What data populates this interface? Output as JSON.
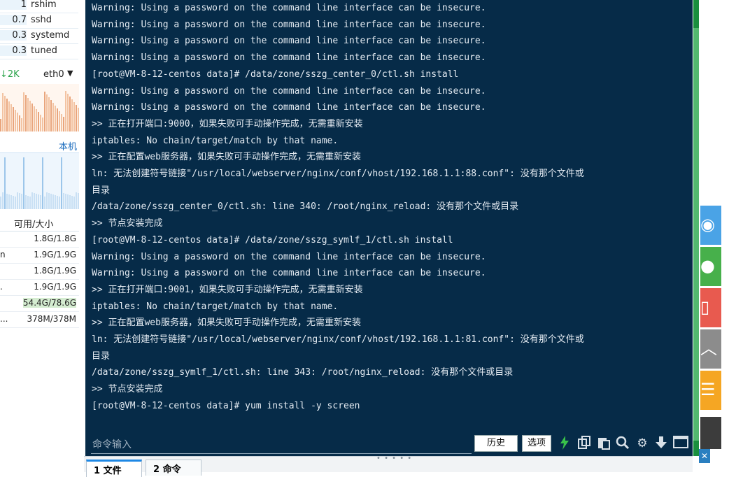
{
  "processes": [
    {
      "mem": "1",
      "name": "rshim"
    },
    {
      "mem": "0.7",
      "name": "sshd"
    },
    {
      "mem": "0.3",
      "name": "systemd"
    },
    {
      "mem": "0.3",
      "name": "tuned"
    }
  ],
  "network": {
    "download": "2K",
    "interface": "eth0"
  },
  "local_label": "本机",
  "disks": {
    "header": "可用/大小",
    "rows": [
      {
        "name": "",
        "value": "1.8G/1.8G"
      },
      {
        "name": "n",
        "value": "1.9G/1.9G"
      },
      {
        "name": "",
        "value": "1.8G/1.9G"
      },
      {
        "name": ".",
        "value": "1.9G/1.9G"
      },
      {
        "name": "",
        "value": "54.4G/78.6G"
      },
      {
        "name": "...",
        "value": "378M/378M"
      }
    ]
  },
  "terminal": {
    "lines": [
      "Warning: Using a password on the command line interface can be insecure.",
      "Warning: Using a password on the command line interface can be insecure.",
      "Warning: Using a password on the command line interface can be insecure.",
      "Warning: Using a password on the command line interface can be insecure.",
      "[root@VM-8-12-centos data]# /data/zone/sszg_center_0/ctl.sh install",
      "Warning: Using a password on the command line interface can be insecure.",
      "Warning: Using a password on the command line interface can be insecure.",
      ">> 正在打开端口:9000，如果失败可手动操作完成，无需重新安装",
      "iptables: No chain/target/match by that name.",
      ">> 正在配置web服务器，如果失败可手动操作完成，无需重新安装",
      "ln: 无法创建符号链接\"/usr/local/webserver/nginx/conf/vhost/192.168.1.1:88.conf\": 没有那个文件或",
      "目录",
      "/data/zone/sszg_center_0/ctl.sh: line 340: /root/nginx_reload: 没有那个文件或目录",
      ">> 节点安装完成",
      "[root@VM-8-12-centos data]# /data/zone/sszg_symlf_1/ctl.sh install",
      "Warning: Using a password on the command line interface can be insecure.",
      "Warning: Using a password on the command line interface can be insecure.",
      ">> 正在打开端口:9001，如果失败可手动操作完成，无需重新安装",
      "iptables: No chain/target/match by that name.",
      ">> 正在配置web服务器，如果失败可手动操作完成，无需重新安装",
      "ln: 无法创建符号链接\"/usr/local/webserver/nginx/conf/vhost/192.168.1.1:81.conf\": 没有那个文件或",
      "目录",
      "/data/zone/sszg_symlf_1/ctl.sh: line 343: /root/nginx_reload: 没有那个文件或目录",
      ">> 节点安装完成",
      "[root@VM-8-12-centos data]# yum install -y screen"
    ],
    "input_placeholder": "命令输入",
    "history_label": "历史",
    "options_label": "选项"
  },
  "icons": {
    "lightning": "lightning-icon",
    "copy": "copy-icon",
    "paste": "paste-icon",
    "search": "search-icon",
    "gear": "gear-icon",
    "down": "arrow-down-icon",
    "window": "window-icon"
  },
  "bottom_tabs": [
    "1 文件",
    "2 命令"
  ],
  "colors": {
    "terminal_bg": "#062b48",
    "terminal_text": "#e4ebf2",
    "side_qq": "#4aa3e6",
    "side_wechat": "#47b04b",
    "side_phone": "#e85a4f",
    "side_top": "#8c8c8c",
    "side_menu": "#f5a623"
  }
}
